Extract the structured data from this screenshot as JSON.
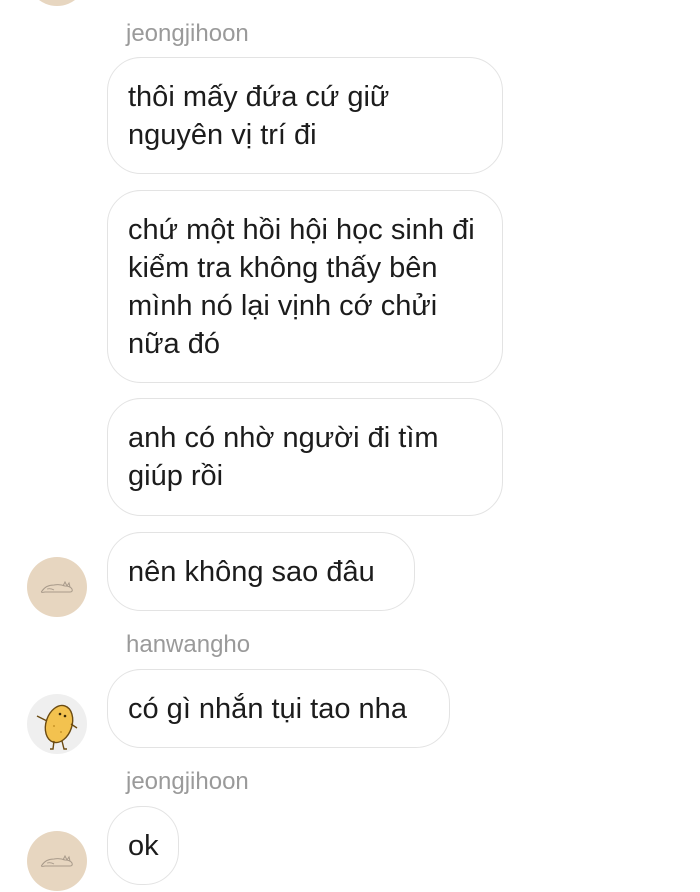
{
  "messages": {
    "sender_1": "jeongjihoon",
    "msg_1": "thôi mấy đứa cứ giữ nguyên vị trí đi",
    "msg_2": "chứ một hồi hội học sinh đi kiểm tra không thấy bên mình nó lại vịnh cớ chửi nữa đó",
    "msg_3": "anh có nhờ người đi tìm giúp rồi",
    "msg_4": "nên không sao đâu",
    "sender_2": "hanwangho",
    "msg_5": "có gì nhắn tụi tao nha",
    "sender_3": "jeongjihoon",
    "msg_6": "ok"
  },
  "avatars": {
    "jeongjihoon_icon": "sleeping-cat-avatar",
    "hanwangho_icon": "potato-character-avatar",
    "bubble_border_color": "#e3e3e3",
    "cat_avatar_bg": "#e7d6c0"
  }
}
